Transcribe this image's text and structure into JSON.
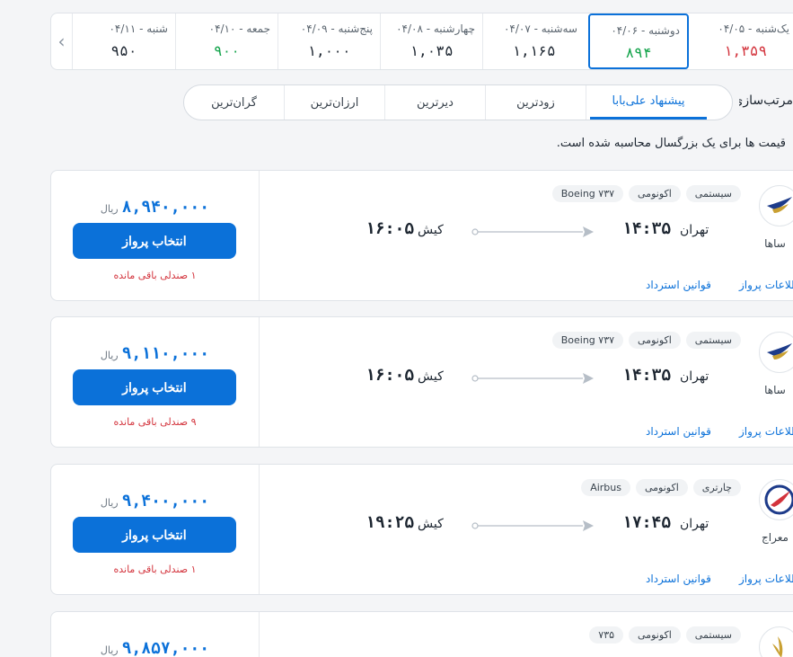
{
  "dates": [
    {
      "label": "شنبه - ۰۴/۱۱",
      "price": "۹۵۰",
      "color": "normal"
    },
    {
      "label": "جمعه - ۰۴/۱۰",
      "price": "۹۰۰",
      "color": "green"
    },
    {
      "label": "پنج‌شنبه - ۰۴/۰۹",
      "price": "۱,۰۰۰",
      "color": "normal"
    },
    {
      "label": "چهارشنبه - ۰۴/۰۸",
      "price": "۱,۰۳۵",
      "color": "normal"
    },
    {
      "label": "سه‌شنبه - ۰۴/۰۷",
      "price": "۱,۱۶۵",
      "color": "normal"
    },
    {
      "label": "دوشنبه - ۰۴/۰۶",
      "price": "۸۹۴",
      "color": "green",
      "active": true
    },
    {
      "label": "یک‌شنبه - ۰۴/۰۵",
      "price": "۱,۳۵۹",
      "color": "red"
    }
  ],
  "sort": {
    "label": "مرتب‌سازی:",
    "options": [
      "گران‌ترین",
      "ارزان‌ترین",
      "دیرترین",
      "زودترین",
      "پیشنهاد علی‌بابا"
    ],
    "active_index": 4
  },
  "note": "قیمت ها برای یک بزرگسال محاسبه شده است.",
  "flights": [
    {
      "airline": "ساها",
      "tags": [
        "سیستمی",
        "اکونومی",
        "Boeing ۷۳۷"
      ],
      "dep_city": "تهران",
      "dep_time": "۱۴:۳۵",
      "arr_city": "کیش",
      "arr_time": "۱۶:۰۵",
      "price": "۸,۹۴۰,۰۰۰",
      "currency": "ریال",
      "button": "انتخاب پرواز",
      "seats": "۱ صندلی باقی مانده",
      "rules": "قوانین استرداد",
      "info": "جزئیات و اطلاعات پرواز",
      "logo": "saha-logo-icon"
    },
    {
      "airline": "ساها",
      "tags": [
        "سیستمی",
        "اکونومی",
        "Boeing ۷۳۷"
      ],
      "dep_city": "تهران",
      "dep_time": "۱۴:۳۵",
      "arr_city": "کیش",
      "arr_time": "۱۶:۰۵",
      "price": "۹,۱۱۰,۰۰۰",
      "currency": "ریال",
      "button": "انتخاب پرواز",
      "seats": "۹ صندلی باقی مانده",
      "rules": "قوانین استرداد",
      "info": "جزئیات و اطلاعات پرواز",
      "logo": "saha-logo-icon"
    },
    {
      "airline": "معراج",
      "tags": [
        "چارتری",
        "اکونومی",
        "Airbus"
      ],
      "dep_city": "تهران",
      "dep_time": "۱۷:۴۵",
      "arr_city": "کیش",
      "arr_time": "۱۹:۲۵",
      "price": "۹,۴۰۰,۰۰۰",
      "currency": "ریال",
      "button": "انتخاب پرواز",
      "seats": "۱ صندلی باقی مانده",
      "rules": "قوانین استرداد",
      "info": "جزئیات و اطلاعات پرواز",
      "logo": "meraj-logo-icon"
    },
    {
      "tags": [
        "سیستمی",
        "اکونومی",
        "۷۳۵"
      ],
      "price": "۹,۸۵۷,۰۰۰",
      "currency": "ریال",
      "logo": "gold-bird-logo-icon"
    }
  ],
  "colors": {
    "accent": "#0b71d9",
    "green": "#12a34a",
    "red": "#d3333c"
  }
}
